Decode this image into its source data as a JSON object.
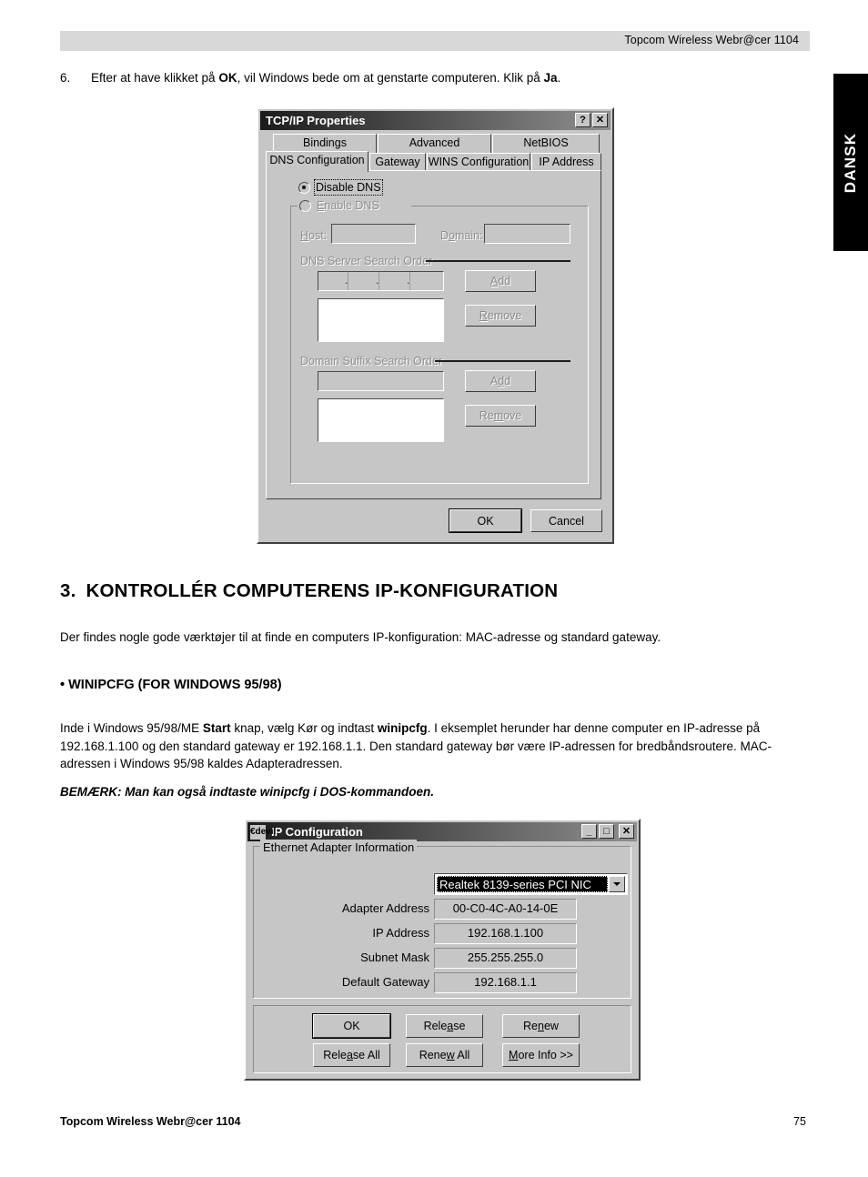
{
  "page": {
    "header_text": "Topcom Wireless Webr@cer 1104",
    "side_tab_label": "DANSK",
    "footer_left": "Topcom Wireless Webr@cer 1104",
    "footer_page_number": "75"
  },
  "step": {
    "number": "6.",
    "text_before_ok": "Efter at have klikket på ",
    "ok_bold": "OK",
    "text_middle": ", vil Windows bede om at genstarte computeren. Klik på ",
    "ja_bold": "Ja",
    "text_end": "."
  },
  "section": {
    "number": "3.",
    "heading": "KONTROLLÉR COMPUTERENS IP-KONFIGURATION",
    "intro": "Der findes nogle gode værktøjer til at finde en computers IP-konfiguration: MAC-adresse og standard gateway.",
    "subheading": "• WINIPCFG (FOR WINDOWS 95/98)",
    "para_1": "Inde i Windows 95/98/ME ",
    "para_bold_start": "Start",
    "para_2": " knap, vælg Kør og indtast ",
    "para_bold_winipcfg": "winipcfg",
    "para_3": ". I eksemplet herunder har denne computer en IP-adresse på 192.168.1.100 og den standard gateway er 192.168.1.1. Den standard gateway bør være IP-adressen for bredbåndsroutere. MAC-adressen i Windows 95/98 kaldes Adapteradressen.",
    "note": "BEMÆRK: Man kan også indtaste winipcfg i DOS-kommandoen."
  },
  "tcpip_dialog": {
    "title": "TCP/IP Properties",
    "help_button": "?",
    "close_button": "✕",
    "tabs_row_back": [
      "Bindings",
      "Advanced",
      "NetBIOS"
    ],
    "tabs_row_front": [
      "DNS Configuration",
      "Gateway",
      "WINS Configuration",
      "IP Address"
    ],
    "active_tab": "DNS Configuration",
    "radio_disable_dns": "Disable DNS",
    "radio_enable_dns": "Enable DNS",
    "selected_radio": "Disable DNS",
    "host_label": "Host:",
    "host_value": "",
    "domain_label": "Domain:",
    "domain_value": "",
    "dns_search_group": "DNS Server Search Order",
    "dns_ip_value": "",
    "dns_add_button": "Add",
    "dns_remove_button": "Remove",
    "domain_suffix_group": "Domain Suffix Search Order",
    "domain_suffix_value": "",
    "suffix_add_button": "Add",
    "suffix_remove_button": "Remove",
    "ok_button": "OK",
    "cancel_button": "Cancel"
  },
  "ipconfig_dialog": {
    "title": "IP Configuration",
    "minimize_button": "_",
    "maximize_button": "□",
    "close_button": "✕",
    "group_label": "Ethernet  Adapter Information",
    "adapter_selected": "Realtek 8139-series PCI NIC",
    "fields": [
      {
        "label": "Adapter Address",
        "value": "00-C0-4C-A0-14-0E"
      },
      {
        "label": "IP Address",
        "value": "192.168.1.100"
      },
      {
        "label": "Subnet Mask",
        "value": "255.255.255.0"
      },
      {
        "label": "Default Gateway",
        "value": "192.168.1.1"
      }
    ],
    "buttons": [
      {
        "label": "OK",
        "default": true
      },
      {
        "label": "Release",
        "default": false
      },
      {
        "label": "Renew",
        "default": false
      },
      {
        "label": "Release All",
        "default": false
      },
      {
        "label": "Renew All",
        "default": false
      },
      {
        "label": "More Info >>",
        "default": false
      }
    ]
  }
}
